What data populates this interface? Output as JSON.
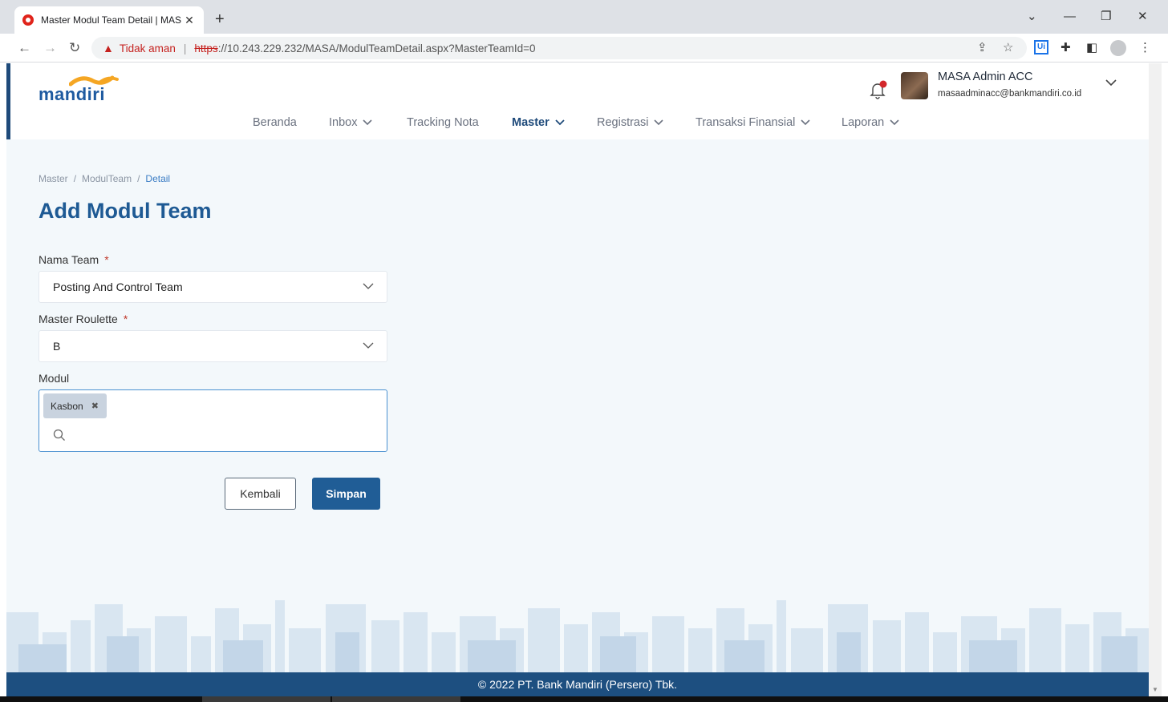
{
  "browser": {
    "tab_title": "Master Modul Team Detail | MAS",
    "new_tab": "+",
    "security_label": "Tidak aman",
    "url_scheme": "https",
    "url_rest": "://10.243.229.232/MASA/ModulTeamDetail.aspx?MasterTeamId=0",
    "ext_label": "Ui"
  },
  "user": {
    "name": "MASA Admin ACC",
    "email": "masaadminacc@bankmandiri.co.id"
  },
  "logo": {
    "text": "mandiri"
  },
  "nav": {
    "beranda": "Beranda",
    "inbox": "Inbox",
    "tracking": "Tracking Nota",
    "master": "Master",
    "registrasi": "Registrasi",
    "transaksi": "Transaksi Finansial",
    "laporan": "Laporan"
  },
  "breadcrumb": {
    "item1": "Master",
    "item2": "ModulTeam",
    "item3": "Detail",
    "sep": "/"
  },
  "page": {
    "title": "Add Modul Team"
  },
  "form": {
    "required_mark": "*",
    "nama_team": {
      "label": "Nama Team",
      "value": "Posting And Control Team"
    },
    "roulette": {
      "label": "Master Roulette",
      "value": "B"
    },
    "modul": {
      "label": "Modul",
      "chips": [
        "Kasbon"
      ]
    }
  },
  "buttons": {
    "back": "Kembali",
    "save": "Simpan"
  },
  "footer": {
    "text": "© 2022 PT. Bank Mandiri (Persero) Tbk."
  },
  "colors": {
    "primary": "#1e5a94",
    "button": "#205d96",
    "footer": "#1d4f80",
    "required": "#c0392b"
  }
}
